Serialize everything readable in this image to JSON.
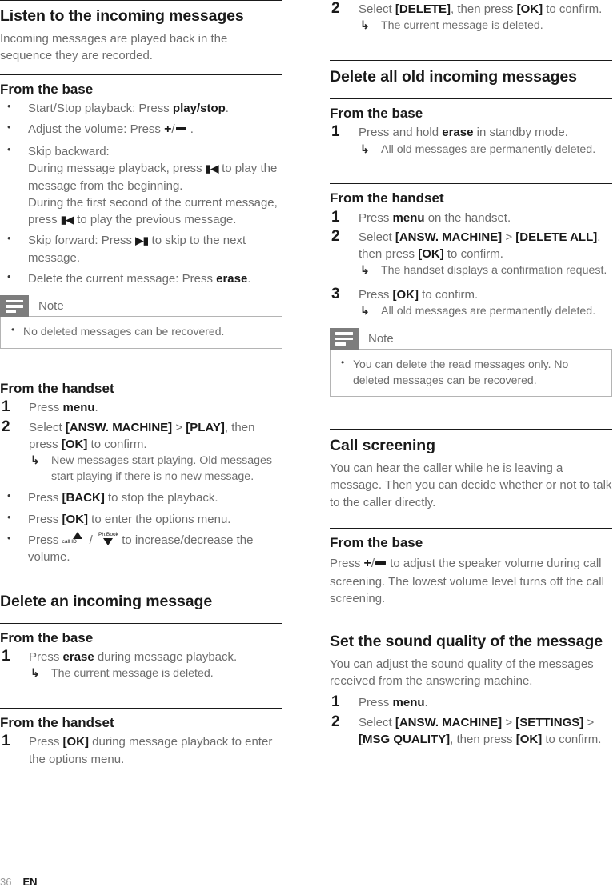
{
  "footer": {
    "page_number": "36",
    "language": "EN"
  },
  "left_column": {
    "listen_section": {
      "title": "Listen to the incoming messages",
      "intro": "Incoming messages are played back in the sequence they are recorded."
    },
    "from_base": {
      "title": "From the base",
      "b1_prefix": "Start/Stop playback: Press ",
      "b1_key": "play/stop",
      "b1_suffix": ".",
      "b2_prefix": "Adjust the volume: Press ",
      "b2_suffix": " .",
      "b3_line1": "Skip backward:",
      "b3_line2_prefix": "During message playback, press ",
      "b3_line2_suffix": " to play the message from the beginning.",
      "b3_line3_prefix": "During the first second of the current message, press ",
      "b3_line3_suffix": " to play the previous message.",
      "b4_prefix": "Skip forward: Press ",
      "b4_suffix": " to skip to the next message.",
      "b5_prefix": "Delete the current message: Press ",
      "b5_key": "erase",
      "b5_suffix": "."
    },
    "note1": {
      "label": "Note",
      "items": [
        "No deleted messages can be recovered."
      ]
    },
    "from_handset": {
      "title": "From the handset",
      "step1_prefix": "Press ",
      "step1_key": "menu",
      "step1_suffix": ".",
      "step2_prefix": "Select ",
      "step2_menu1": "[ANSW. MACHINE]",
      "step2_gt": " > ",
      "step2_menu2": "[PLAY]",
      "step2_mid": ", then press ",
      "step2_ok": "[OK]",
      "step2_suffix": " to confirm.",
      "step2_result": "New messages start playing. Old messages start playing if there is no new message.",
      "b1_prefix": "Press ",
      "b1_key": "[BACK]",
      "b1_suffix": " to stop the playback.",
      "b2_prefix": "Press ",
      "b2_key": "[OK]",
      "b2_suffix": " to enter the options menu.",
      "b3_prefix": "Press ",
      "b3_mid": " / ",
      "b3_suffix": " to increase/decrease the volume.",
      "key_up_label": "call ID",
      "key_down_label": "Ph.Book"
    },
    "delete_section": {
      "title": "Delete an incoming message"
    },
    "delete_from_base": {
      "title": "From the base",
      "step1_prefix": "Press ",
      "step1_key": "erase",
      "step1_suffix": " during message playback.",
      "step1_result": "The current message is deleted."
    },
    "delete_from_handset": {
      "title": "From the handset",
      "step1_prefix": "Press ",
      "step1_key": "[OK]",
      "step1_suffix": " during message playback to enter the options menu."
    }
  },
  "right_column": {
    "delete_from_handset_cont": {
      "step2_prefix": "Select ",
      "step2_menu": "[DELETE]",
      "step2_mid": ", then press ",
      "step2_ok": "[OK]",
      "step2_suffix": " to confirm.",
      "step2_result": "The current message is deleted."
    },
    "delete_all_section": {
      "title": "Delete all old incoming messages"
    },
    "delete_all_from_base": {
      "title": "From the base",
      "step1_prefix": "Press and hold ",
      "step1_key": "erase",
      "step1_suffix": " in standby mode.",
      "step1_result": "All old messages are permanently deleted."
    },
    "delete_all_from_handset": {
      "title": "From the handset",
      "step1_prefix": "Press ",
      "step1_key": "menu",
      "step1_suffix": " on the handset.",
      "step2_prefix": "Select ",
      "step2_menu1": "[ANSW. MACHINE]",
      "step2_gt": " > ",
      "step2_menu2": "[DELETE ALL]",
      "step2_mid": ", then press ",
      "step2_ok": "[OK]",
      "step2_suffix": " to confirm.",
      "step2_result": "The handset displays a confirmation request.",
      "step3_prefix": "Press ",
      "step3_ok": "[OK]",
      "step3_suffix": " to confirm.",
      "step3_result": "All old messages are permanently deleted."
    },
    "note2": {
      "label": "Note",
      "items": [
        "You can delete the read messages only. No deleted messages can be recovered."
      ]
    },
    "call_screening": {
      "title": "Call screening",
      "intro": "You can hear the caller while he is leaving a message. Then you can decide whether or not to talk to the caller directly."
    },
    "call_screening_base": {
      "title": "From the base",
      "para_prefix": "Press ",
      "para_suffix": " to adjust the speaker volume during call screening. The lowest volume level turns off the call screening."
    },
    "sound_quality": {
      "title": "Set the sound quality of the message",
      "intro": "You can adjust the sound quality of the messages received from the answering machine.",
      "step1_prefix": "Press ",
      "step1_key": "menu",
      "step1_suffix": ".",
      "step2_prefix": "Select ",
      "step2_menu1": "[ANSW. MACHINE]",
      "step2_gt1": " > ",
      "step2_menu2": "[SETTINGS]",
      "step2_gt2": " > ",
      "step2_menu3": "[MSG QUALITY]",
      "step2_mid": ", then ",
      "step2_press": "press ",
      "step2_ok": "[OK]",
      "step2_suffix": " to confirm."
    }
  },
  "icons": {
    "note_badge": "note-lines-icon",
    "skip_back": "skip-backward-icon",
    "skip_forward": "skip-forward-icon",
    "volume_up": "volume-plus-icon",
    "volume_down": "volume-minus-icon",
    "nav_up": "nav-up-callid-icon",
    "nav_down": "nav-down-phonebook-icon"
  },
  "colors": {
    "heading": "#1a1a1a",
    "body": "#6d6d6d",
    "rule": "#1a1a1a",
    "note_badge_bg": "#7d7d7d",
    "note_border": "#b4b4b4"
  }
}
